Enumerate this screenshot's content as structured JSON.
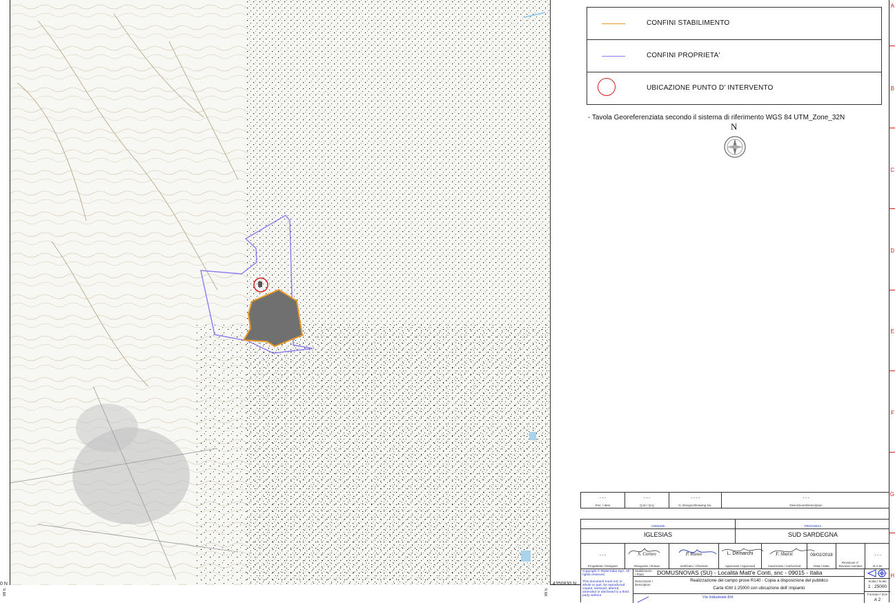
{
  "legend": {
    "items": [
      {
        "label": "CONFINI STABILIMENTO",
        "color": "#e89a2a",
        "icon": "orange-line"
      },
      {
        "label": "CONFINI PROPRIETA'",
        "color": "#8c7cf0",
        "icon": "purple-line"
      },
      {
        "label": "UBICAZIONE PUNTO D' INTERVENTO",
        "color": "#d52020",
        "icon": "red-circle"
      }
    ]
  },
  "note": "- Tavola Georeferenziata secondo il sistema di riferimento WGS 84 UTM_Zone_32N",
  "north_label": "N",
  "grid_refs": [
    "A",
    "B",
    "C",
    "D",
    "E",
    "F",
    "G",
    "H"
  ],
  "coords": {
    "left_bottom": "0 N",
    "center_bottom": "4350830 N",
    "left_vertical": "98 E",
    "center_vertical": "99 E"
  },
  "revision_table": {
    "values": [
      "- - -",
      "- - -",
      "- - - -",
      "- - -"
    ],
    "headers": [
      "Pos. / Item",
      "Q.tà / Q.ty",
      "N. Disegno/Drawing No.",
      "Descrizione/Description"
    ]
  },
  "title_block": {
    "comune_label": "COMUNE",
    "comune": "IGLESIAS",
    "provincia_label": "PROVINCIA",
    "provincia": "SUD SARDEGNA",
    "people": {
      "progettista": "- - -",
      "disegnato": "S. Corteo",
      "verificato": "P. Russo",
      "approvato": "L. Demarchi",
      "autorizzato": "F. Sbarzi",
      "data": "09/02/2018",
      "revisione": "- - -"
    },
    "roles": [
      "Progettista / Designer",
      "Disegnato / Drawn",
      "Verificato / Checked",
      "Approvato / Approved",
      "Autorizzato / Authorized",
      "Data / Date",
      "Revisione n° Revision number",
      "R.A.M."
    ],
    "copyright": "Copyright © RWM Italia SpA. All rights reserved.",
    "disclaimer": "This document must not, in whole or part, be reproduced, copied, reissued, altered, amended or disclosed to a third party without",
    "stabilimento_label": "Stabilimento / Plant",
    "plant": "DOMUSNOVAS (SU) - Località Matt'e Conti, snc - 09015 - Italia",
    "descrizione_label": "Descrizione / Description",
    "desc1": "Realizzazione del campo prove R140 - Copia a disposizione del pubblico",
    "desc2": "Carta IGM 1:25000 con ubicazione dell' impianto",
    "address": "Via Industriale 8/d",
    "scale_label": "Scala / Scale",
    "scale": "1 : 25000",
    "format_label": "Formato / Size",
    "format": "A 2"
  },
  "map_colors": {
    "terrain": "#f7f7f4",
    "contour": "#c9b99a",
    "town": "#b9b9b9",
    "plant_fill": "#707070",
    "plant_border": "#e89a2a",
    "property": "#8c7cf0",
    "marker": "#d52020"
  }
}
